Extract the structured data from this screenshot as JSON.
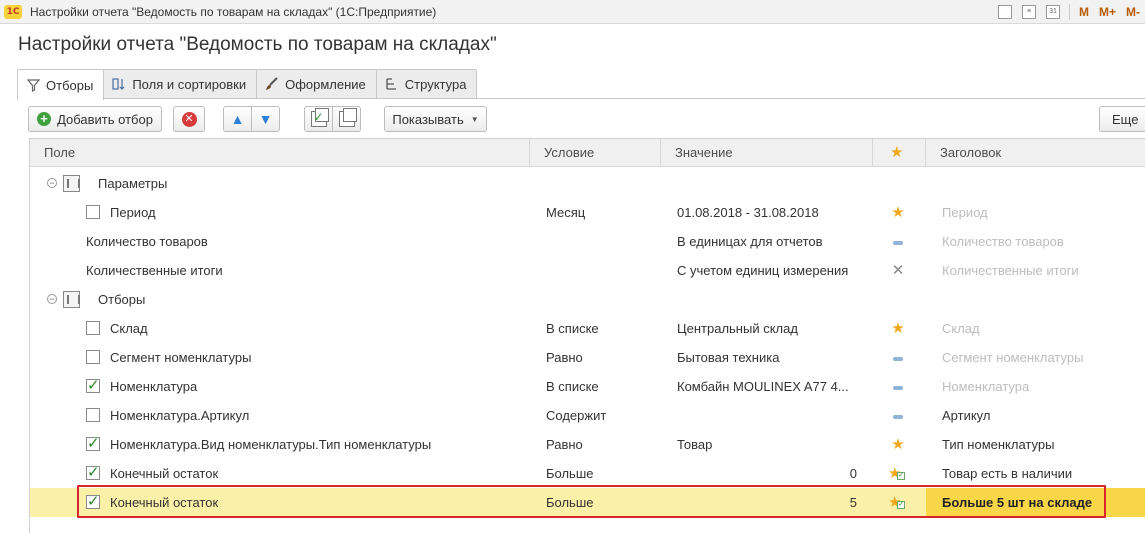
{
  "window": {
    "logo": "1С",
    "title": "Настройки отчета \"Ведомость по товарам на складах\"  (1С:Предприятие)",
    "tools": [
      "calendar-icon",
      "list-icon",
      "calendar-31-icon"
    ],
    "calendar_day": "31",
    "memory": [
      "M",
      "M+",
      "M-"
    ]
  },
  "page": {
    "title": "Настройки отчета \"Ведомость по товарам на складах\""
  },
  "tabs": [
    {
      "label": "Отборы",
      "icon": "filter-icon",
      "active": true
    },
    {
      "label": "Поля и сортировки",
      "icon": "fields-sort-icon",
      "active": false
    },
    {
      "label": "Оформление",
      "icon": "brush-icon",
      "active": false
    },
    {
      "label": "Структура",
      "icon": "structure-icon",
      "active": false
    }
  ],
  "toolbar": {
    "add_filter": "Добавить отбор",
    "show_label": "Показывать",
    "more_label": "Еще"
  },
  "table": {
    "columns": [
      "Поле",
      "Условие",
      "Значение",
      "★",
      "Заголовок"
    ],
    "rows": [
      {
        "type": "group",
        "field": "Параметры"
      },
      {
        "type": "item",
        "checkbox": false,
        "field": "Период",
        "condition": "Месяц",
        "value": "01.08.2018 - 31.08.2018",
        "mark": "star",
        "header": "Период",
        "header_muted": true
      },
      {
        "type": "param",
        "field": "Количество товаров",
        "condition": "",
        "value": "В единицах для отчетов",
        "mark": "dash",
        "header": "Количество товаров",
        "header_muted": true
      },
      {
        "type": "param",
        "field": "Количественные итоги",
        "condition": "",
        "value": "С учетом единиц измерения",
        "mark": "x",
        "header": "Количественные итоги",
        "header_muted": true
      },
      {
        "type": "group",
        "field": "Отборы"
      },
      {
        "type": "item",
        "checkbox": false,
        "field": "Склад",
        "condition": "В списке",
        "value": "Центральный склад",
        "mark": "star",
        "header": "Склад",
        "header_muted": true
      },
      {
        "type": "item",
        "checkbox": false,
        "field": "Сегмент номенклатуры",
        "condition": "Равно",
        "value": "Бытовая техника",
        "mark": "dash",
        "header": "Сегмент номенклатуры",
        "header_muted": true
      },
      {
        "type": "item",
        "checkbox": true,
        "field": "Номенклатура",
        "condition": "В списке",
        "value": "Комбайн MOULINEX  A77 4...",
        "mark": "dash",
        "header": "Номенклатура",
        "header_muted": true
      },
      {
        "type": "item",
        "checkbox": false,
        "field": "Номенклатура.Артикул",
        "condition": "Содержит",
        "value": "",
        "mark": "dash",
        "header": "Артикул",
        "header_muted": false
      },
      {
        "type": "item",
        "checkbox": true,
        "field": "Номенклатура.Вид номенклатуры.Тип номенклатуры",
        "condition": "Равно",
        "value": "Товар",
        "mark": "star",
        "header": "Тип номенклатуры",
        "header_muted": false
      },
      {
        "type": "item",
        "checkbox": true,
        "field": "Конечный остаток",
        "condition": "Больше",
        "value": "0",
        "value_numeric": true,
        "mark": "star-check",
        "header": "Товар есть в наличии",
        "header_muted": false
      },
      {
        "type": "item",
        "checkbox": true,
        "field": "Конечный остаток",
        "condition": "Больше",
        "value": "5",
        "value_numeric": true,
        "mark": "star-check",
        "header": "Больше 5 шт на складе",
        "header_muted": false,
        "selected": true
      }
    ]
  },
  "colors": {
    "selected_row": "#fbf0a8",
    "selected_header_cell": "#f9d548",
    "highlight_frame": "#d6262b",
    "star": "#f0a81c"
  }
}
